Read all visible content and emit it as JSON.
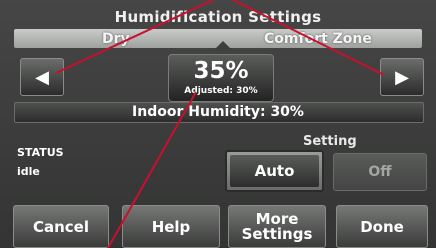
{
  "header": {
    "title": "Humidification Settings"
  },
  "range": {
    "left_label": "Dry",
    "right_label": "Comfort Zone"
  },
  "adjust": {
    "decrease_icon": "left-triangle-icon",
    "increase_icon": "right-triangle-icon",
    "value": "35%",
    "adjusted": "Adjusted: 30%"
  },
  "indoor": {
    "text": "Indoor Humidity: 30%"
  },
  "status": {
    "label": "STATUS",
    "value": "idle"
  },
  "setting": {
    "label": "Setting",
    "auto": "Auto",
    "off": "Off"
  },
  "footer": {
    "cancel": "Cancel",
    "help": "Help",
    "more_line1": "More",
    "more_line2": "Settings",
    "done": "Done"
  },
  "colors": {
    "callout_line": "#c8102e",
    "background": "#3b3c3b"
  }
}
